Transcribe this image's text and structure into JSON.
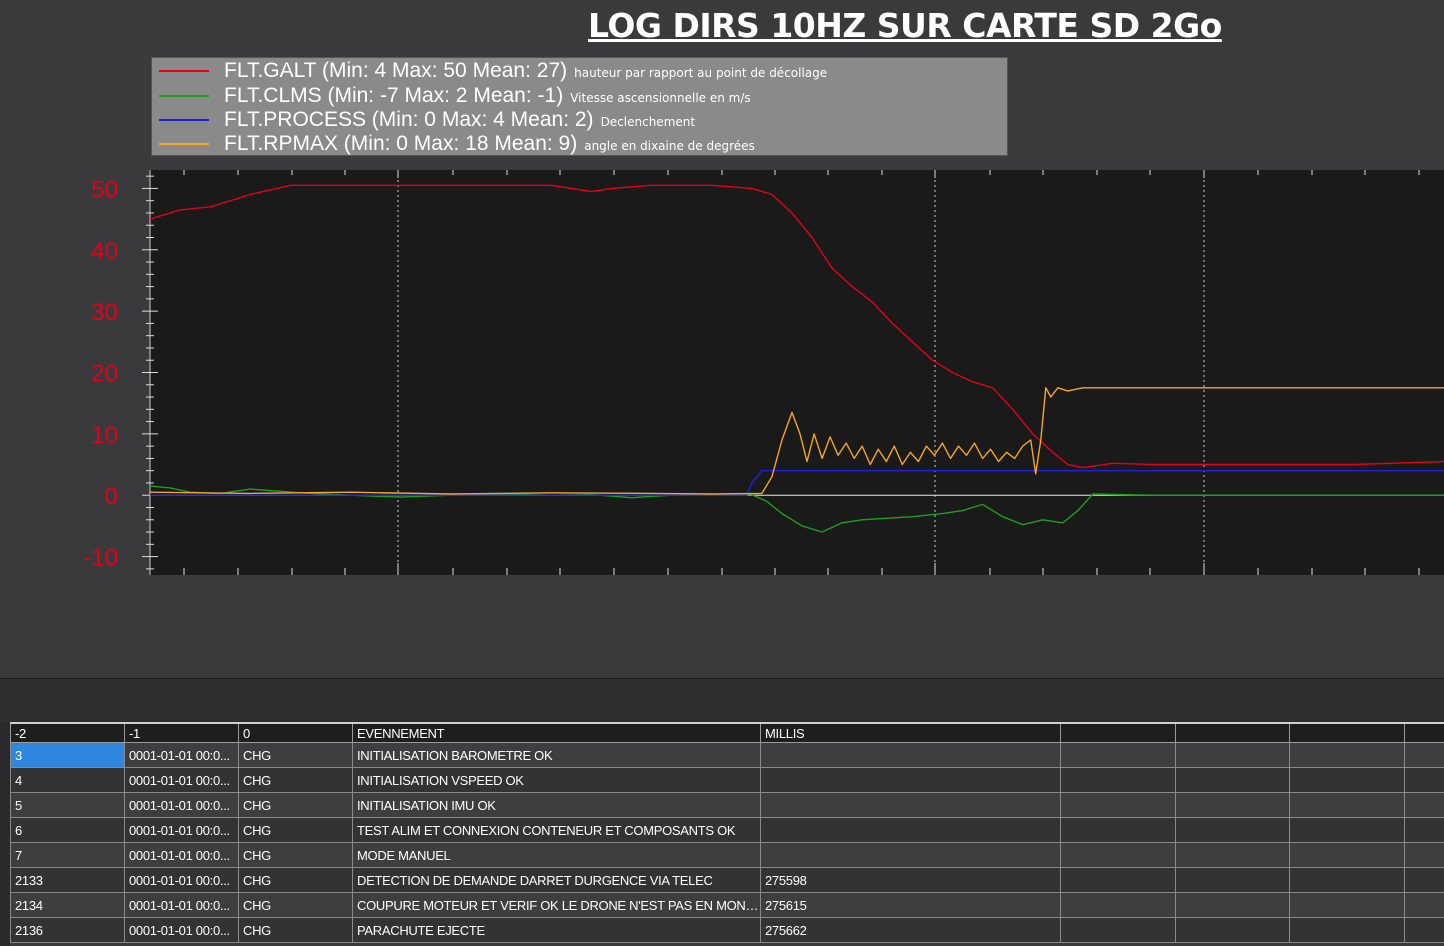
{
  "title": "LOG DIRS 10HZ SUR CARTE SD 2Go",
  "legend": [
    {
      "label": "FLT.GALT (Min: 4 Max: 50 Mean: 27)",
      "note": "hauteur par rapport au point de décollage",
      "color": "#e3001b"
    },
    {
      "label": "FLT.CLMS (Min: -7 Max: 2 Mean: -1)",
      "note": "Vitesse ascensionnelle en m/s",
      "color": "#1e9e1e"
    },
    {
      "label": "FLT.PROCESS (Min: 0 Max: 4 Mean: 2)",
      "note": "Declenchement",
      "color": "#2020dd"
    },
    {
      "label": "FLT.RPMAX (Min: 0 Max: 18 Mean: 9)",
      "note": "angle en dixaine de degrées",
      "color": "#f5a623"
    }
  ],
  "chart_data": {
    "type": "line",
    "title": "LOG DIRS 10HZ SUR CARTE SD 2Go",
    "xlabel": "",
    "ylabel": "",
    "ylim": [
      -13,
      53
    ],
    "xlim": [
      0,
      1290
    ],
    "ytick_labels": [
      "50",
      "40",
      "30",
      "20",
      "10",
      "0",
      "-10"
    ],
    "ytick_values": [
      50,
      40,
      30,
      20,
      10,
      0,
      -10
    ],
    "ytick_color": "#e3001b",
    "grid": "vertical dotted",
    "legend_position": "top-left",
    "series": [
      {
        "name": "FLT.GALT",
        "color": "#e3001b",
        "x": [
          0,
          30,
          60,
          100,
          140,
          200,
          300,
          400,
          440,
          460,
          500,
          560,
          600,
          620,
          640,
          660,
          680,
          700,
          720,
          740,
          760,
          780,
          800,
          820,
          840,
          860,
          880,
          900,
          915,
          930,
          960,
          1000,
          1100,
          1200,
          1290
        ],
        "y": [
          45,
          46.5,
          47,
          49,
          50.5,
          50.5,
          50.5,
          50.5,
          49.5,
          50,
          50.5,
          50.5,
          50,
          49,
          46,
          42,
          37,
          34,
          31.5,
          28,
          25,
          22,
          20,
          18.5,
          17.5,
          14,
          10,
          7,
          5,
          4.5,
          5.2,
          5,
          5,
          5,
          5.5
        ]
      },
      {
        "name": "FLT.CLMS",
        "color": "#1e9e1e",
        "x": [
          0,
          20,
          40,
          70,
          100,
          150,
          200,
          250,
          300,
          350,
          400,
          440,
          480,
          520,
          560,
          600,
          615,
          630,
          650,
          670,
          690,
          710,
          730,
          760,
          790,
          810,
          830,
          850,
          870,
          890,
          910,
          925,
          940,
          1000,
          1100,
          1200,
          1290
        ],
        "y": [
          1.5,
          1.2,
          0.5,
          0.3,
          1,
          0.4,
          0,
          -0.3,
          0,
          0.2,
          0,
          0.1,
          -0.4,
          0,
          0,
          0.1,
          -1,
          -3,
          -5,
          -6,
          -4.5,
          -4,
          -3.8,
          -3.5,
          -3,
          -2.5,
          -1.5,
          -3.5,
          -4.8,
          -4,
          -4.5,
          -2.5,
          0.2,
          0,
          0,
          0,
          0
        ]
      },
      {
        "name": "FLT.PROCESS",
        "color": "#2020dd",
        "x": [
          0,
          595,
          600,
          610,
          1290
        ],
        "y": [
          0,
          0,
          2,
          4,
          4
        ]
      },
      {
        "name": "FLT.RPMAX",
        "color": "#f5a623",
        "x": [
          0,
          100,
          200,
          300,
          400,
          500,
          560,
          610,
          620,
          630,
          640,
          648,
          655,
          662,
          670,
          678,
          686,
          694,
          702,
          710,
          718,
          726,
          734,
          742,
          750,
          758,
          766,
          774,
          782,
          790,
          798,
          806,
          814,
          822,
          830,
          838,
          846,
          854,
          862,
          870,
          878,
          883,
          888,
          893,
          898,
          905,
          915,
          930,
          1000,
          1100,
          1200,
          1290
        ],
        "y": [
          0.5,
          0.3,
          0.5,
          0.2,
          0.4,
          0.3,
          0.2,
          0.3,
          3,
          9,
          13.5,
          10,
          5.5,
          10,
          6,
          9.5,
          6.5,
          8.5,
          6,
          8,
          5,
          7.5,
          5.5,
          8,
          5,
          7,
          5.5,
          8,
          6.5,
          8.5,
          6,
          8,
          6.5,
          8.5,
          6,
          7.5,
          5.5,
          7,
          6,
          8,
          9,
          3.5,
          9,
          17.5,
          16,
          17.5,
          17,
          17.5,
          17.5,
          17.5,
          17.5,
          17.5
        ]
      }
    ]
  },
  "table": {
    "headers": [
      "-2",
      "-1",
      "0",
      "EVENNEMENT",
      "MILLIS",
      "",
      "",
      "",
      ""
    ],
    "rows": [
      [
        "3",
        "0001-01-01 00:0...",
        "CHG",
        "INITIALISATION BAROMETRE OK",
        "",
        "",
        "",
        "",
        ""
      ],
      [
        "4",
        "0001-01-01 00:0...",
        "CHG",
        "INITIALISATION VSPEED OK",
        "",
        "",
        "",
        "",
        ""
      ],
      [
        "5",
        "0001-01-01 00:0...",
        "CHG",
        "INITIALISATION IMU OK",
        "",
        "",
        "",
        "",
        ""
      ],
      [
        "6",
        "0001-01-01 00:0...",
        "CHG",
        "TEST ALIM ET CONNEXION CONTENEUR ET COMPOSANTS OK",
        "",
        "",
        "",
        "",
        ""
      ],
      [
        "7",
        "0001-01-01 00:0...",
        "CHG",
        "MODE MANUEL",
        "",
        "",
        "",
        "",
        ""
      ],
      [
        "2133",
        "0001-01-01 00:0...",
        "CHG",
        "DETECTION DE DEMANDE DARRET DURGENCE VIA TELEC",
        "275598",
        "",
        "",
        "",
        ""
      ],
      [
        "2134",
        "0001-01-01 00:0...",
        "CHG",
        "COUPURE MOTEUR ET VERIF OK LE DRONE N'EST PAS EN MONTE",
        "275615",
        "",
        "",
        "",
        ""
      ],
      [
        "2136",
        "0001-01-01 00:0...",
        "CHG",
        "PARACHUTE EJECTE",
        "275662",
        "",
        "",
        "",
        ""
      ]
    ]
  }
}
